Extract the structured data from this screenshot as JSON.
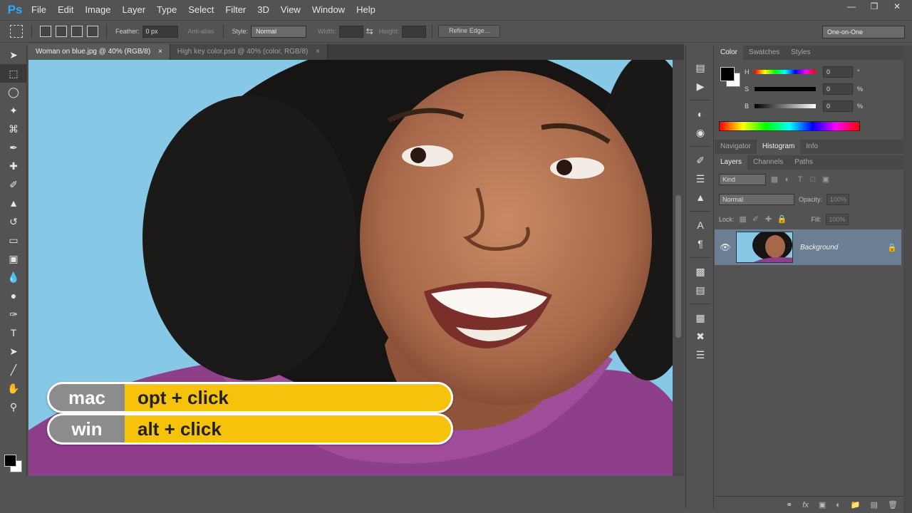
{
  "app": {
    "logo": "Ps"
  },
  "menu": [
    "File",
    "Edit",
    "Image",
    "Layer",
    "Type",
    "Select",
    "Filter",
    "3D",
    "View",
    "Window",
    "Help"
  ],
  "options": {
    "feather_label": "Feather:",
    "feather_value": "0 px",
    "antialias_label": "Anti-alias",
    "style_label": "Style:",
    "style_value": "Normal",
    "width_label": "Width:",
    "height_label": "Height:",
    "refine_label": "Refine Edge...",
    "workspace": "One-on-One"
  },
  "tabs": [
    {
      "label": "Woman on blue.jpg @ 40% (RGB/8)"
    },
    {
      "label": "High key color.psd @ 40% (color, RGB/8)"
    }
  ],
  "shortcut": {
    "mac_os": "mac",
    "mac_keys": "opt + click",
    "win_os": "win",
    "win_keys": "alt + click"
  },
  "color_panel": {
    "tabs": [
      "Color",
      "Swatches",
      "Styles"
    ],
    "h_label": "H",
    "h_value": "0",
    "h_unit": "°",
    "s_label": "S",
    "s_value": "0",
    "s_unit": "%",
    "b_label": "B",
    "b_value": "0",
    "b_unit": "%"
  },
  "nav_panel": {
    "tabs": [
      "Navigator",
      "Histogram",
      "Info"
    ]
  },
  "layers_panel": {
    "tabs": [
      "Layers",
      "Channels",
      "Paths"
    ],
    "kind": "Kind",
    "blend_mode": "Normal",
    "opacity_label": "Opacity:",
    "opacity_value": "100%",
    "lock_label": "Lock:",
    "fill_label": "Fill:",
    "fill_value": "100%",
    "layer_name": "Background"
  },
  "colors": {
    "accent": "#31a8ff",
    "banner_yellow": "#f6c20b",
    "banner_gray": "#8c8c8c",
    "layer_selected": "#6a7f94",
    "sky": "#87c8e6"
  }
}
